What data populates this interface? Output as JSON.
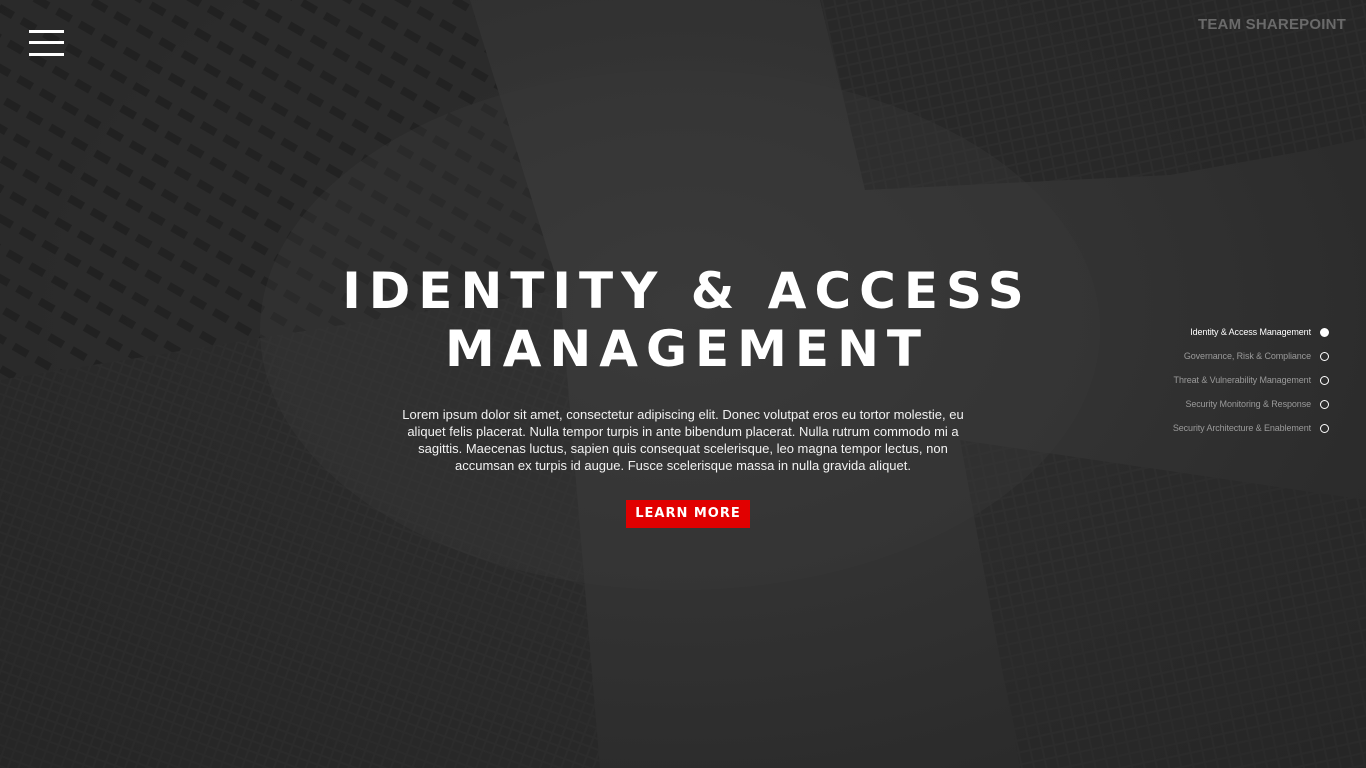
{
  "header": {
    "brand": "TEAM SHAREPOINT",
    "menu_icon": "hamburger-menu-icon"
  },
  "hero": {
    "title": "IDENTITY & ACCESS MANAGEMENT",
    "body": "Lorem ipsum dolor sit amet, consectetur adipiscing elit. Donec volutpat eros eu tortor molestie, eu aliquet felis placerat. Nulla tempor turpis in ante bibendum placerat. Nulla rutrum commodo mi a sagittis. Maecenas luctus, sapien quis consequat scelerisque, leo magna tempor lectus, non accumsan ex turpis id augue. Fusce scelerisque massa in nulla gravida aliquet.",
    "cta_label": "LEARN MORE"
  },
  "dot_nav": {
    "items": [
      {
        "label": "Identity & Access Management",
        "active": true
      },
      {
        "label": "Governance, Risk & Compliance",
        "active": false
      },
      {
        "label": "Threat & Vulnerability Management",
        "active": false
      },
      {
        "label": "Security Monitoring & Response",
        "active": false
      },
      {
        "label": "Security Architecture & Enablement",
        "active": false
      }
    ]
  },
  "colors": {
    "accent": "#e10000",
    "background": "#2f2f2f",
    "text": "#ffffff"
  }
}
